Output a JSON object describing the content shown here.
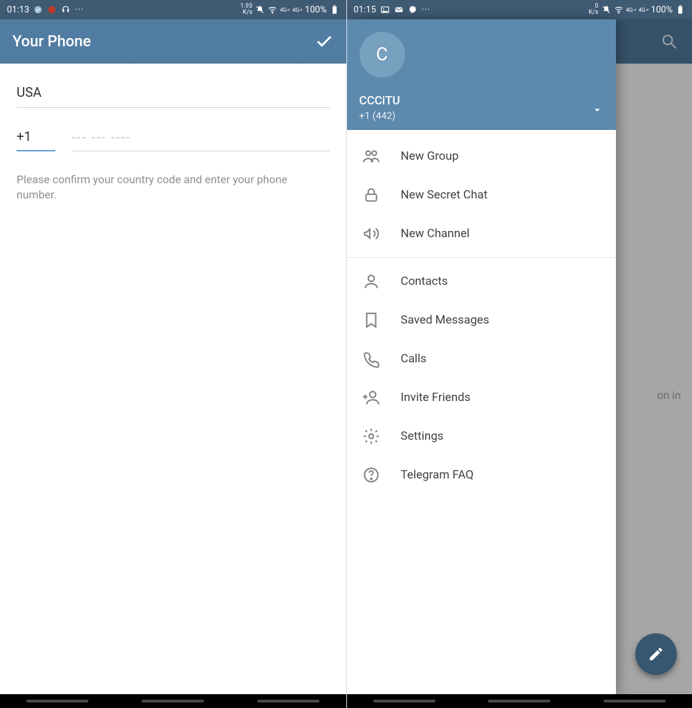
{
  "left": {
    "status": {
      "time": "01:13",
      "speed_top": "1.93",
      "speed_unit": "K/s",
      "battery": "100%"
    },
    "header": {
      "title": "Your Phone"
    },
    "country": "USA",
    "dial_code": "+1",
    "number_placeholder": "--- --- ----",
    "hint": "Please confirm your country code and enter your phone number."
  },
  "right": {
    "status": {
      "time": "01:15",
      "speed_top": "0",
      "speed_unit": "K/s",
      "battery": "100%"
    },
    "bg_text": "on in",
    "drawer": {
      "avatar_letter": "C",
      "username": "CCCiTU",
      "phone": "+1 (442)",
      "items": [
        {
          "icon": "group-icon",
          "label": "New Group"
        },
        {
          "icon": "lock-icon",
          "label": "New Secret Chat"
        },
        {
          "icon": "megaphone-icon",
          "label": "New Channel"
        }
      ],
      "items2": [
        {
          "icon": "person-icon",
          "label": "Contacts"
        },
        {
          "icon": "bookmark-icon",
          "label": "Saved Messages"
        },
        {
          "icon": "phone-icon",
          "label": "Calls"
        },
        {
          "icon": "invite-icon",
          "label": "Invite Friends"
        },
        {
          "icon": "gear-icon",
          "label": "Settings"
        },
        {
          "icon": "help-icon",
          "label": "Telegram FAQ"
        }
      ]
    }
  }
}
